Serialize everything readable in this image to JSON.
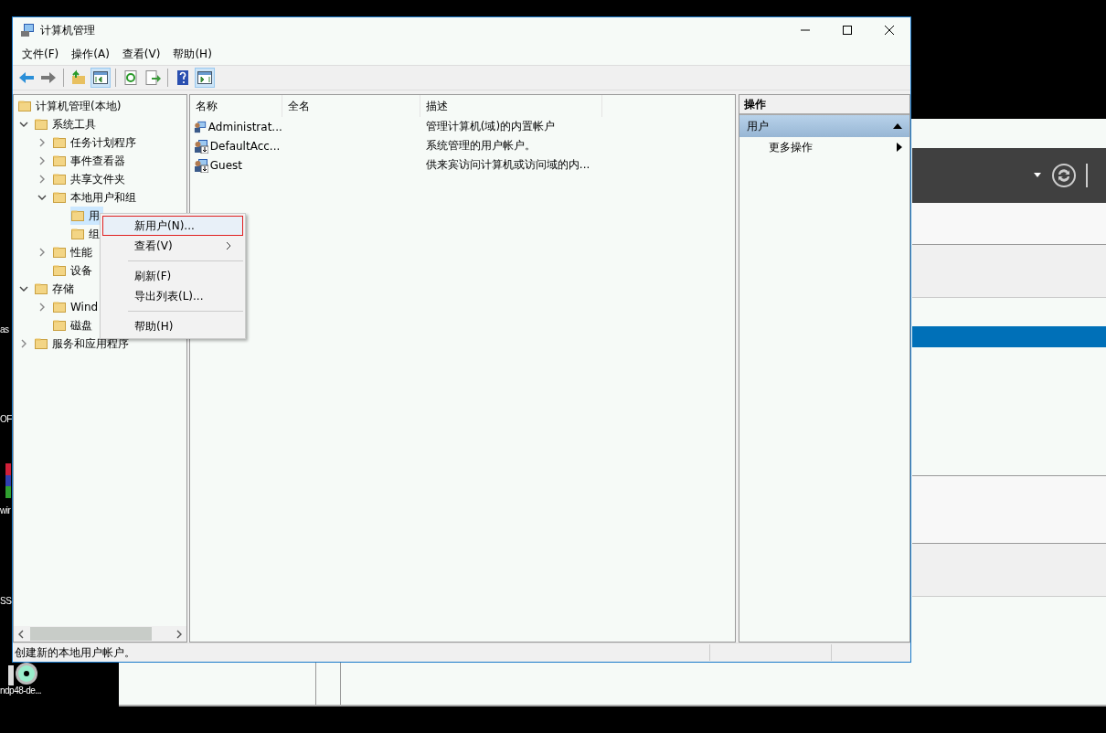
{
  "window": {
    "title": "计算机管理"
  },
  "menu": [
    "文件(F)",
    "操作(A)",
    "查看(V)",
    "帮助(H)"
  ],
  "toolbar": [
    [
      {
        "kind": "back",
        "pressed": false
      },
      {
        "kind": "forward",
        "pressed": false
      }
    ],
    [
      {
        "kind": "up",
        "pressed": false
      },
      {
        "kind": "tree-pane",
        "pressed": true
      }
    ],
    [
      {
        "kind": "refresh",
        "pressed": false
      },
      {
        "kind": "export",
        "pressed": false
      }
    ],
    [
      {
        "kind": "help",
        "pressed": false
      },
      {
        "kind": "action-pane",
        "pressed": true
      }
    ]
  ],
  "tree": {
    "label": "计算机管理(本地)",
    "selected": false,
    "children": [
      {
        "label": "系统工具",
        "expandable": true,
        "expanded": true,
        "selected": false,
        "children": [
          {
            "label": "任务计划程序",
            "expandable": true,
            "expanded": false,
            "selected": false
          },
          {
            "label": "事件查看器",
            "expandable": true,
            "expanded": false,
            "selected": false
          },
          {
            "label": "共享文件夹",
            "expandable": true,
            "expanded": false,
            "selected": false
          },
          {
            "label": "本地用户和组",
            "expandable": true,
            "expanded": true,
            "selected": false,
            "children": [
              {
                "label": "用",
                "expandable": false,
                "selected": true
              },
              {
                "label": "组",
                "expandable": false,
                "selected": false
              }
            ]
          },
          {
            "label": "性能",
            "expandable": true,
            "expanded": false,
            "selected": false
          },
          {
            "label": "设备",
            "expandable": false,
            "selected": false
          }
        ]
      },
      {
        "label": "存储",
        "expandable": true,
        "expanded": true,
        "selected": false,
        "children": [
          {
            "label": "Wind",
            "expandable": true,
            "expanded": false,
            "selected": false
          },
          {
            "label": "磁盘",
            "expandable": false,
            "selected": false
          }
        ]
      },
      {
        "label": "服务和应用程序",
        "expandable": true,
        "expanded": false,
        "selected": false
      }
    ]
  },
  "list": {
    "columns": [
      "名称",
      "全名",
      "描述"
    ],
    "rows": [
      {
        "name": "Administrat...",
        "disabled": false,
        "description": "管理计算机(域)的内置帐户"
      },
      {
        "name": "DefaultAcc...",
        "disabled": true,
        "description": "系统管理的用户帐户。"
      },
      {
        "name": "Guest",
        "disabled": true,
        "description": "供来宾访问计算机或访问域的内..."
      }
    ]
  },
  "actions": {
    "header": "操作",
    "sections": [
      {
        "title": "用户",
        "expanded": true,
        "items": [
          {
            "label": "更多操作",
            "submenu": true
          }
        ]
      }
    ]
  },
  "context_menu": {
    "items": [
      {
        "kind": "item",
        "label": "新用户(N)...",
        "highlighted": true,
        "submenu": false
      },
      {
        "kind": "item",
        "label": "查看(V)",
        "highlighted": false,
        "submenu": true
      },
      {
        "kind": "separator"
      },
      {
        "kind": "item",
        "label": "刷新(F)",
        "highlighted": false,
        "submenu": false
      },
      {
        "kind": "item",
        "label": "导出列表(L)...",
        "highlighted": false,
        "submenu": false
      },
      {
        "kind": "separator"
      },
      {
        "kind": "item",
        "label": "帮助(H)",
        "highlighted": false,
        "submenu": false
      }
    ]
  },
  "status_bar": {
    "text": "创建新的本地用户帐户。"
  },
  "desktop": {
    "labels": [
      "as",
      "OF",
      "wir",
      "SS",
      "ndp48-de..."
    ]
  }
}
